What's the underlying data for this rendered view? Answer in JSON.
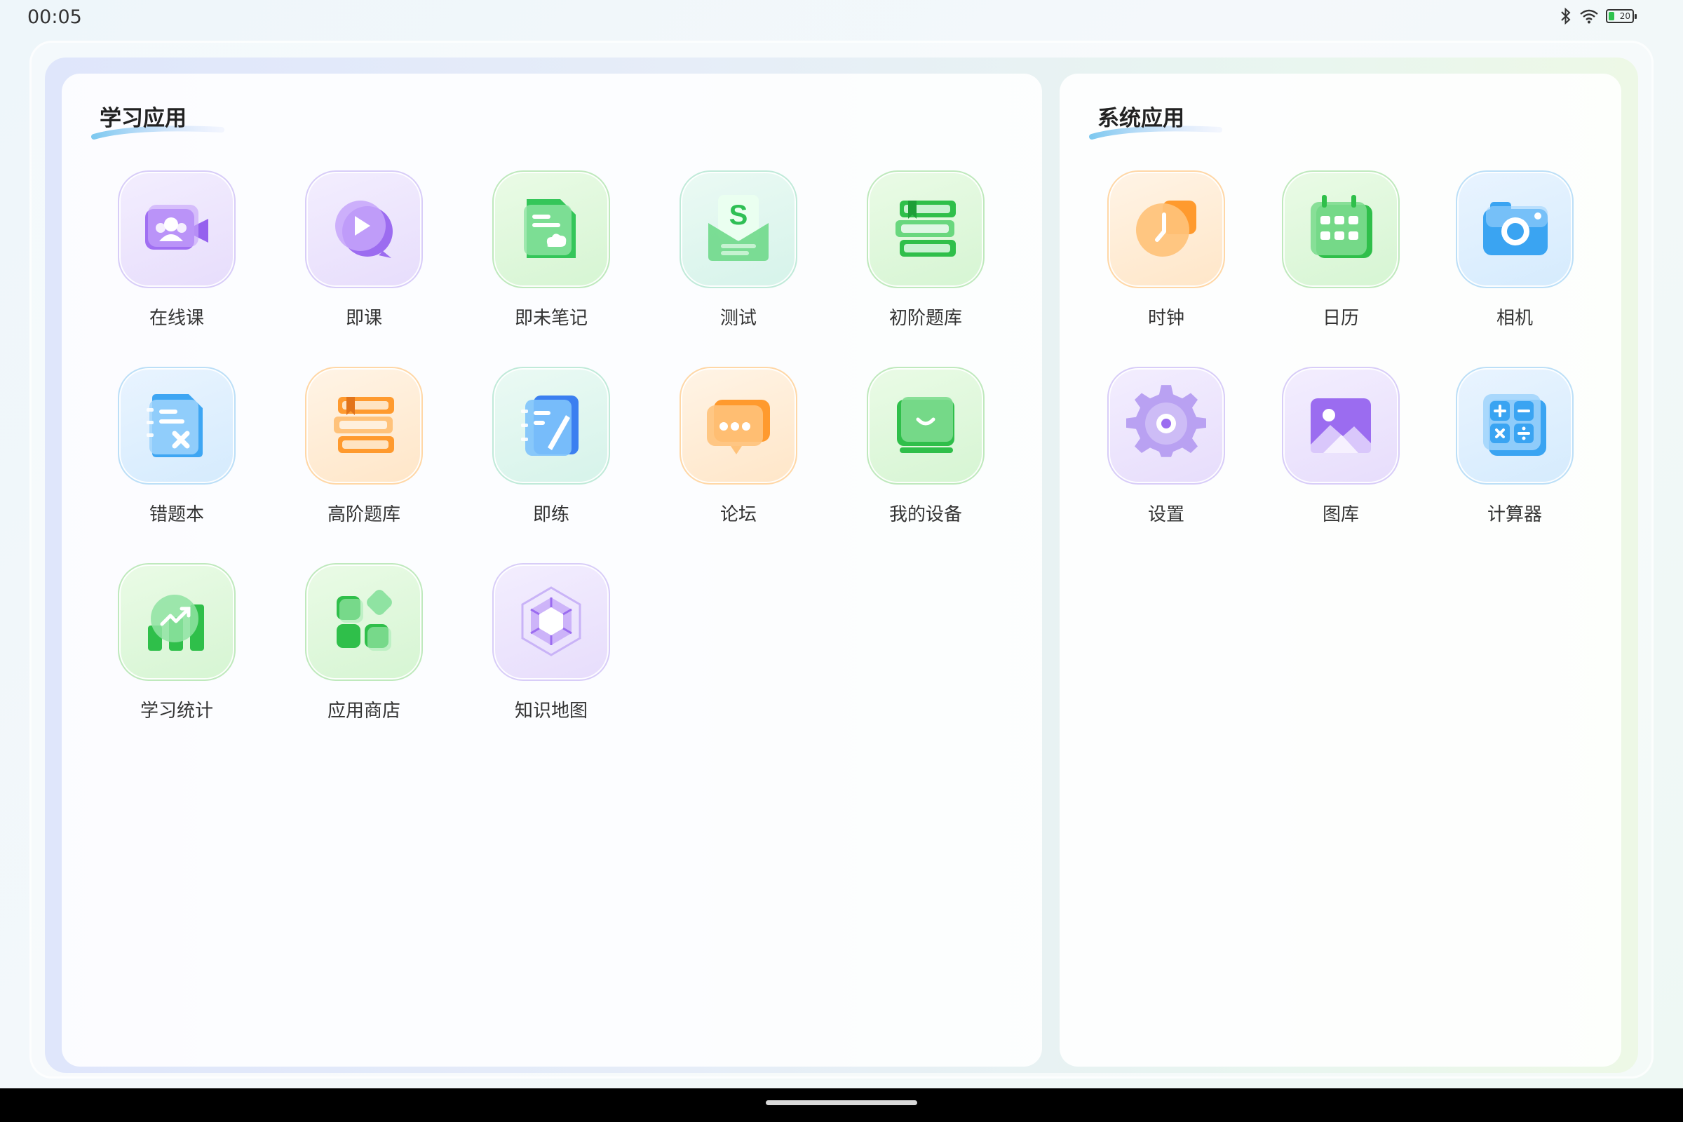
{
  "status_bar": {
    "time": "00:05",
    "battery_level": "20"
  },
  "panels": {
    "learning": {
      "title": "学习应用",
      "apps": [
        {
          "label": "在线课",
          "icon": "video-class-icon"
        },
        {
          "label": "即课",
          "icon": "play-bubble-icon"
        },
        {
          "label": "即未笔记",
          "icon": "note-doc-icon"
        },
        {
          "label": "测试",
          "icon": "test-envelope-icon"
        },
        {
          "label": "初阶题库",
          "icon": "book-stack-green-icon"
        },
        {
          "label": "错题本",
          "icon": "wrong-answer-book-icon"
        },
        {
          "label": "高阶题库",
          "icon": "book-stack-orange-icon"
        },
        {
          "label": "即练",
          "icon": "practice-notebook-icon"
        },
        {
          "label": "论坛",
          "icon": "forum-chat-icon"
        },
        {
          "label": "我的设备",
          "icon": "my-device-icon"
        },
        {
          "label": "学习统计",
          "icon": "learning-stats-icon"
        },
        {
          "label": "应用商店",
          "icon": "app-store-icon"
        },
        {
          "label": "知识地图",
          "icon": "knowledge-map-icon"
        }
      ]
    },
    "system": {
      "title": "系统应用",
      "apps": [
        {
          "label": "时钟",
          "icon": "clock-icon"
        },
        {
          "label": "日历",
          "icon": "calendar-icon"
        },
        {
          "label": "相机",
          "icon": "camera-icon"
        },
        {
          "label": "设置",
          "icon": "settings-gear-icon"
        },
        {
          "label": "图库",
          "icon": "gallery-icon"
        },
        {
          "label": "计算器",
          "icon": "calculator-icon"
        }
      ]
    }
  },
  "colors": {
    "purple": "#9b6cf0",
    "green": "#2fc24a",
    "orange": "#ff9a2e",
    "blue": "#3aa4f2"
  }
}
